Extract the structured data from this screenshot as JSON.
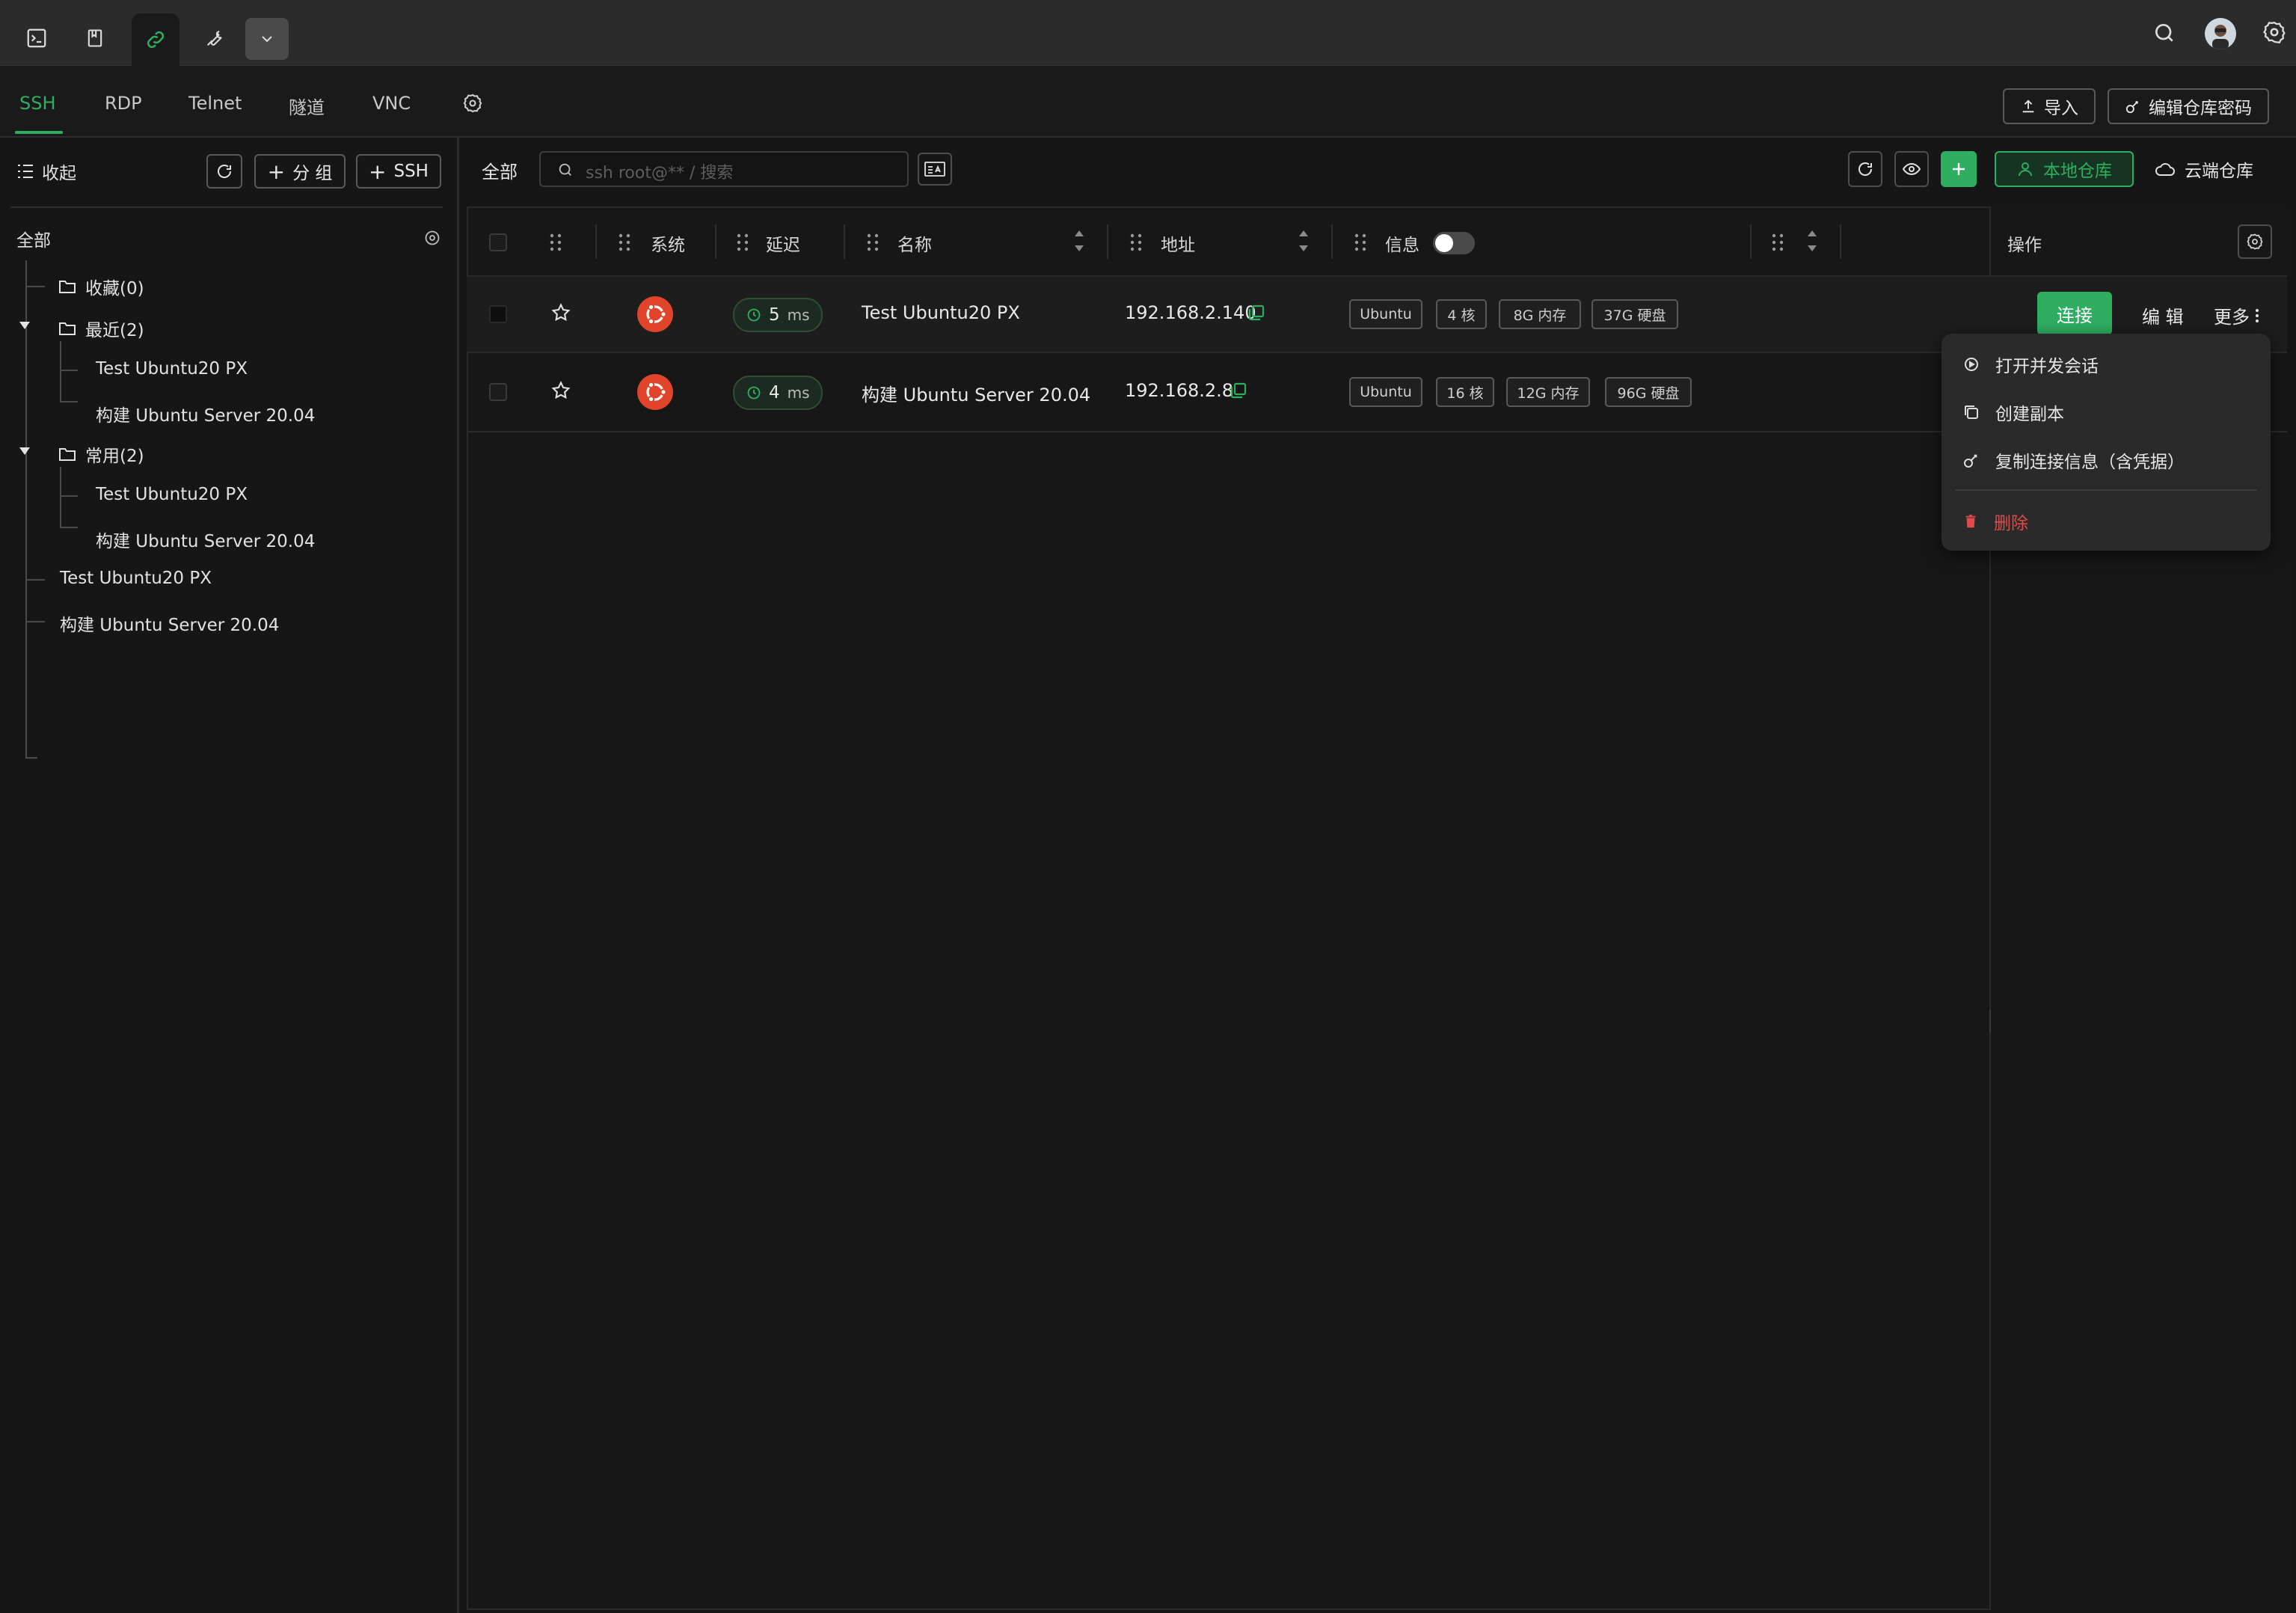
{
  "topbar": {
    "icons": [
      "terminal-icon",
      "bookmark-icon",
      "link-icon",
      "wrench-icon",
      "chevron-down-icon"
    ],
    "right_icons": [
      "search-icon",
      "avatar",
      "settings-icon"
    ]
  },
  "protocol_tabs": [
    "SSH",
    "RDP",
    "Telnet",
    "隧道",
    "VNC"
  ],
  "header_buttons": {
    "import": "导入",
    "edit_repo_password": "编辑仓库密码"
  },
  "sidebar": {
    "collapse": "收起",
    "add_group": "分 组",
    "add_ssh": "SSH",
    "all": "全部",
    "tree": {
      "favorites": "收藏(0)",
      "recent": "最近(2)",
      "recent_items": [
        "Test Ubuntu20 PX",
        "构建 Ubuntu Server 20.04"
      ],
      "common": "常用(2)",
      "common_items": [
        "Test Ubuntu20 PX",
        "构建 Ubuntu Server 20.04"
      ],
      "root_items": [
        "Test Ubuntu20 PX",
        "构建 Ubuntu Server 20.04"
      ]
    }
  },
  "toolbar": {
    "scope": "全部",
    "search_placeholder": "ssh root@** / 搜索",
    "local_repo": "本地仓库",
    "cloud_repo": "云端仓库"
  },
  "table": {
    "headers": {
      "system": "系统",
      "latency": "延迟",
      "name": "名称",
      "address": "地址",
      "info": "信息",
      "actions": "操作"
    },
    "rows": [
      {
        "latency": "5",
        "latency_unit": "ms",
        "name": "Test Ubuntu20 PX",
        "address": "192.168.2.140",
        "tags": [
          "Ubuntu",
          "4 核",
          "8G 内存",
          "37G 硬盘"
        ],
        "os": "ubuntu"
      },
      {
        "latency": "4",
        "latency_unit": "ms",
        "name": "构建 Ubuntu Server 20.04",
        "address": "192.168.2.8",
        "tags": [
          "Ubuntu",
          "16 核",
          "12G 内存",
          "96G 硬盘"
        ],
        "os": "ubuntu"
      }
    ],
    "row_actions": {
      "connect": "连接",
      "edit": "编 辑",
      "more": "更多"
    }
  },
  "more_menu": {
    "open_concurrent": "打开并发会话",
    "duplicate": "创建副本",
    "copy_info": "复制连接信息（含凭据）",
    "delete": "删除"
  },
  "colors": {
    "accent": "#2fae62",
    "danger": "#e04a4a",
    "ubuntu": "#e0442a"
  }
}
